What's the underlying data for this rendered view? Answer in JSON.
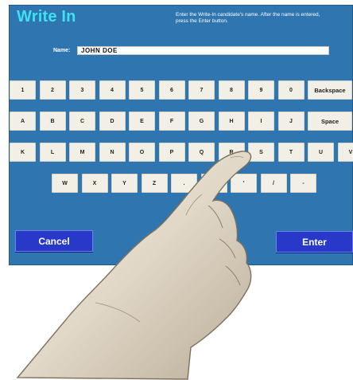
{
  "screen": {
    "title": "Write In",
    "instructions": [
      "Enter the Write-In candidate's name. After the name is entered,",
      "press the Enter button."
    ],
    "name_label": "Name:",
    "name_value": "JOHN  DOE"
  },
  "keyboard": {
    "row1": [
      "1",
      "2",
      "3",
      "4",
      "5",
      "6",
      "7",
      "8",
      "9",
      "0"
    ],
    "row1_wide": "Backspace",
    "row2": [
      "A",
      "B",
      "C",
      "D",
      "E",
      "F",
      "G",
      "H",
      "I",
      "J"
    ],
    "row2_wide": "Space",
    "row3": [
      "K",
      "L",
      "M",
      "N",
      "O",
      "P",
      "Q",
      "R",
      "S",
      "T",
      "U",
      "V"
    ],
    "row4": [
      "W",
      "X",
      "Y",
      "Z",
      ".",
      ",",
      "'",
      "/",
      "-"
    ]
  },
  "buttons": {
    "cancel": "Cancel",
    "enter": "Enter"
  },
  "colors": {
    "screen_bg": "#2f75b0",
    "title": "#3fe0f0",
    "key_bg": "#f1efe6",
    "button_bg": "#2838c8"
  }
}
